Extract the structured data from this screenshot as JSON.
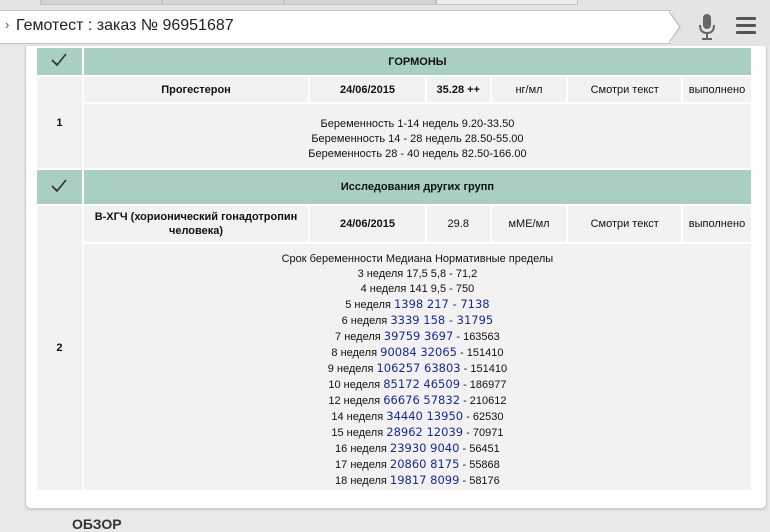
{
  "browser": {
    "url_title": "Гемотест : заказ № 96951687",
    "chevron": "›"
  },
  "groups": [
    {
      "title": "ГОРМОНЫ",
      "row_number": "1",
      "test": {
        "name": "Прогестерон",
        "date": "24/06/2015",
        "result": "35.28 ++",
        "unit": "нг/мл",
        "reference": "Смотри текст",
        "status": "выполнено"
      },
      "note_lines": [
        "Беременность 1-14 недель 9.20-33.50",
        "Беременность 14 - 28 недель 28.50-55.00",
        "Беременность 28 - 40 недель 82.50-166.00"
      ]
    },
    {
      "title": "Исследования других групп",
      "row_number": "2",
      "test": {
        "name": "В-ХГЧ (хорионический гонадотропин человека)",
        "date": "24/06/2015",
        "result": "29.8",
        "unit": "мМЕ/мл",
        "reference": "Смотри текст",
        "status": "выполнено"
      },
      "note_header": "Срок беременности Медиана Нормативные пределы",
      "note_rows": [
        {
          "week": "3 неделя",
          "median": "17,5",
          "low": "5,8",
          "high": "71,2",
          "blue": false
        },
        {
          "week": "4 неделя",
          "median": "141",
          "low": "9,5",
          "high": "750",
          "blue": false
        },
        {
          "week": "5 неделя",
          "median": "1398",
          "low": "217",
          "high": "7138",
          "blue": true,
          "blue_high": true
        },
        {
          "week": "6 неделя",
          "median": "3339",
          "low": "158",
          "high": "31795",
          "blue": true,
          "blue_high": true
        },
        {
          "week": "7 неделя",
          "median": "39759",
          "low": "3697",
          "high": "163563",
          "blue": true,
          "blue_high": false
        },
        {
          "week": "8 неделя",
          "median": "90084",
          "low": "32065",
          "high": "151410",
          "blue": true,
          "blue_high": false
        },
        {
          "week": "9 неделя",
          "median": "106257",
          "low": "63803",
          "high": "151410",
          "blue": true,
          "blue_high": false
        },
        {
          "week": "10 неделя",
          "median": "85172",
          "low": "46509",
          "high": "186977",
          "blue": true,
          "blue_high": false
        },
        {
          "week": "12 неделя",
          "median": "66676",
          "low": "57832",
          "high": "210612",
          "blue": true,
          "blue_high": false
        },
        {
          "week": "14 неделя",
          "median": "34440",
          "low": "13950",
          "high": "62530",
          "blue": true,
          "blue_high": false
        },
        {
          "week": "15 неделя",
          "median": "28962",
          "low": "12039",
          "high": "70971",
          "blue": true,
          "blue_high": false
        },
        {
          "week": "16 неделя",
          "median": "23930",
          "low": "9040",
          "high": "56451",
          "blue": true,
          "blue_high": false
        },
        {
          "week": "17 неделя",
          "median": "20860",
          "low": "8175",
          "high": "55868",
          "blue": true,
          "blue_high": false
        },
        {
          "week": "18 неделя",
          "median": "19817",
          "low": "8099",
          "high": "58176",
          "blue": true,
          "blue_high": false
        }
      ]
    }
  ],
  "footer_partial_text": "ОБЗОР",
  "colors": {
    "group_header_bg": "#a9cfc1",
    "cell_bg": "#f2f2f2",
    "link_blue": "#1a2a8f"
  },
  "icons": {
    "group_check": "checkmark-icon",
    "voice": "microphone-icon",
    "menu": "hamburger-menu-icon"
  }
}
